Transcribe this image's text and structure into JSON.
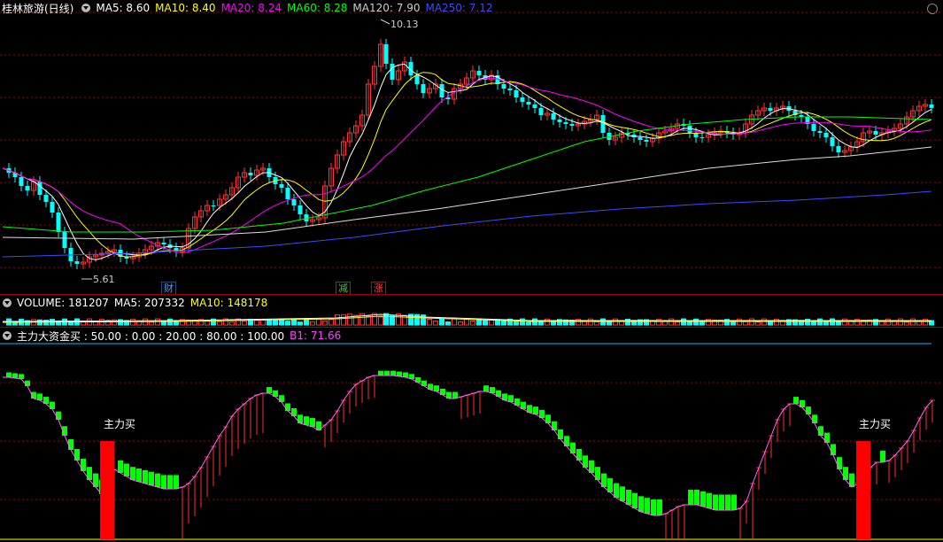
{
  "price_panel": {
    "title": "桂林旅游(日线)",
    "ma": [
      {
        "label": "MA5: 8.60",
        "color": "#ffffff"
      },
      {
        "label": "MA10: 8.40",
        "color": "#ffff00"
      },
      {
        "label": "MA20: 8.24",
        "color": "#ff00ff"
      },
      {
        "label": "MA60: 8.28",
        "color": "#00ff00"
      },
      {
        "label": "MA120: 7.90",
        "color": "#cccccc"
      },
      {
        "label": "MA250: 7.12",
        "color": "#3a4bff"
      }
    ],
    "high_label": "10.13",
    "low_label": "5.61",
    "badges": [
      {
        "text": "财",
        "color": "#4aa0ff"
      },
      {
        "text": "减",
        "color": "#33cc33"
      },
      {
        "text": "涨",
        "color": "#ff4444"
      }
    ]
  },
  "volume_panel": {
    "title": "VOLUME: 181207",
    "ma5": "MA5: 207332",
    "ma10": "MA10: 148178"
  },
  "indicator_panel": {
    "title": "主力大资金买 : 50.00 : 0.00 : 20.00 : 80.00 : 100.00",
    "b1": "B1: 71.66",
    "signal_label": "主力买"
  },
  "colors": {
    "up": "#ff3333",
    "down": "#00ffff",
    "bull": "#ff3030",
    "bear": "#00ff00",
    "grid": "#a00000"
  },
  "chart_data": {
    "type": "candlestick",
    "price_range": [
      5.61,
      10.13
    ],
    "ma_values": {
      "MA5": 8.6,
      "MA10": 8.4,
      "MA20": 8.24,
      "MA60": 8.28,
      "MA120": 7.9,
      "MA250": 7.12
    },
    "indicator_levels": [
      0.0,
      20.0,
      50.0,
      80.0,
      100.0
    ],
    "B1": 71.66
  }
}
